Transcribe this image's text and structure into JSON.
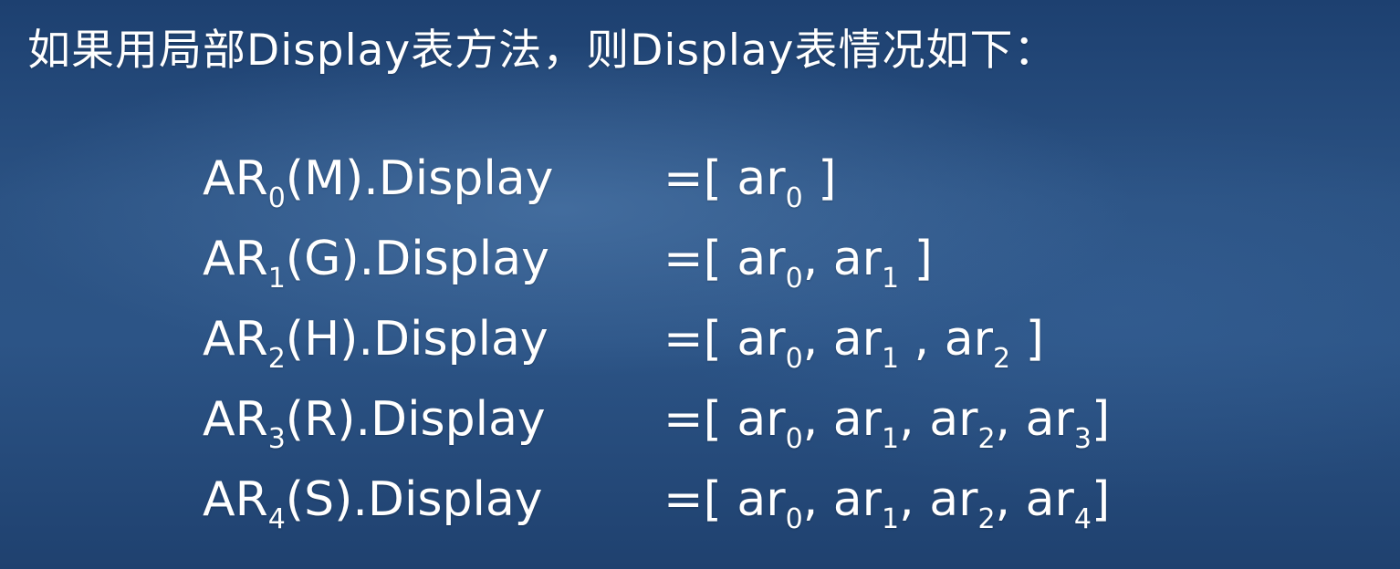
{
  "heading": "如果用局部Display表方法，则Display表情况如下：",
  "rows": [
    {
      "lhs": {
        "pre": "AR",
        "sub": "0",
        "post": "(M).Display"
      },
      "rhs": {
        "open": "=[ ",
        "terms": [
          {
            "base": "ar",
            "sub": "0",
            "sep": " "
          }
        ],
        "close": "]"
      }
    },
    {
      "lhs": {
        "pre": "AR",
        "sub": "1",
        "post": "(G).Display"
      },
      "rhs": {
        "open": "=[ ",
        "terms": [
          {
            "base": "ar",
            "sub": "0",
            "sep": ", "
          },
          {
            "base": "ar",
            "sub": "1",
            "sep": " "
          }
        ],
        "close": "]"
      }
    },
    {
      "lhs": {
        "pre": "AR",
        "sub": "2",
        "post": "(H).Display"
      },
      "rhs": {
        "open": "=[ ",
        "terms": [
          {
            "base": "ar",
            "sub": "0",
            "sep": ", "
          },
          {
            "base": "ar",
            "sub": "1",
            "sep": " , "
          },
          {
            "base": "ar",
            "sub": "2",
            "sep": " "
          }
        ],
        "close": "]"
      }
    },
    {
      "lhs": {
        "pre": "AR",
        "sub": "3",
        "post": "(R).Display"
      },
      "rhs": {
        "open": "=[ ",
        "terms": [
          {
            "base": "ar",
            "sub": "0",
            "sep": ", "
          },
          {
            "base": "ar",
            "sub": "1",
            "sep": ", "
          },
          {
            "base": "ar",
            "sub": "2",
            "sep": ", "
          },
          {
            "base": "ar",
            "sub": "3",
            "sep": ""
          }
        ],
        "close": "]"
      }
    },
    {
      "lhs": {
        "pre": "AR",
        "sub": "4",
        "post": "(S).Display"
      },
      "rhs": {
        "open": "=[ ",
        "terms": [
          {
            "base": "ar",
            "sub": "0",
            "sep": ", "
          },
          {
            "base": "ar",
            "sub": "1",
            "sep": ", "
          },
          {
            "base": "ar",
            "sub": "2",
            "sep": ", "
          },
          {
            "base": "ar",
            "sub": "4",
            "sep": ""
          }
        ],
        "close": "]"
      }
    }
  ]
}
